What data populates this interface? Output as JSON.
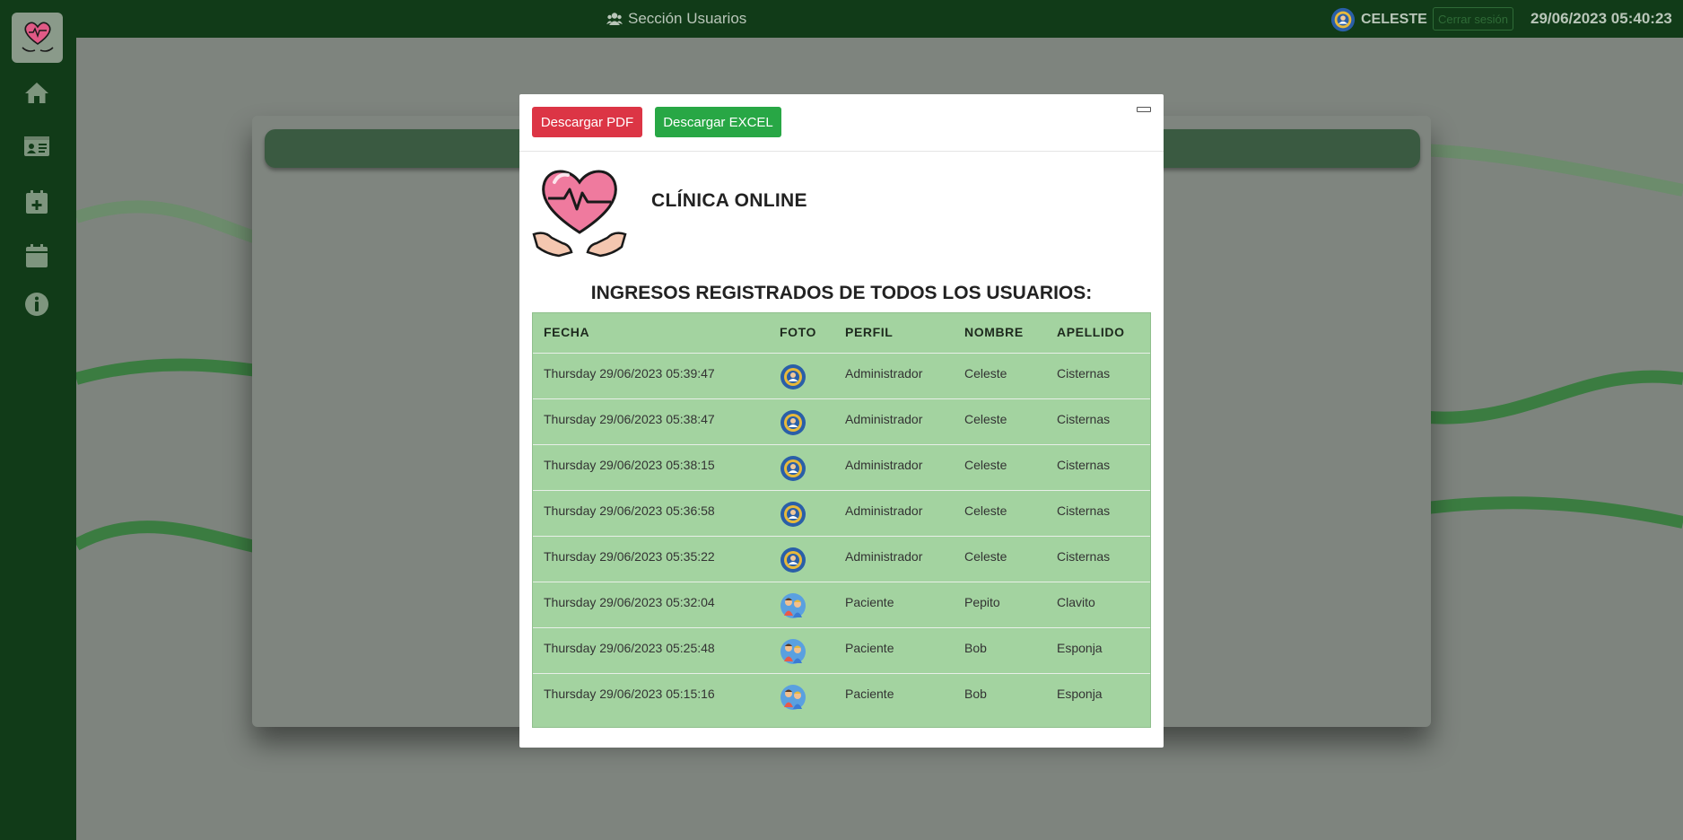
{
  "topbar": {
    "section_title": "Sección Usuarios",
    "section_icon": "users-icon",
    "user_name": "CELESTE",
    "user_icon": "admin-gear-avatar",
    "logout_label": "Cerrar sesión",
    "datetime": "29/06/2023 05:40:23"
  },
  "sidebar": {
    "logo_icon": "heart-hands-logo",
    "items": [
      {
        "icon": "home-icon"
      },
      {
        "icon": "id-card-icon"
      },
      {
        "icon": "calendar-plus-icon"
      },
      {
        "icon": "calendar-icon"
      },
      {
        "icon": "info-icon"
      }
    ]
  },
  "modal": {
    "pdf_label": "Descargar PDF",
    "excel_label": "Descargar EXCEL",
    "clinic_name": "CLÍNICA ONLINE",
    "report_title": "INGRESOS REGISTRADOS DE TODOS LOS USUARIOS:",
    "table": {
      "headers": [
        "FECHA",
        "FOTO",
        "PERFIL",
        "NOMBRE",
        "APELLIDO"
      ],
      "rows": [
        {
          "fecha": "Thursday 29/06/2023 05:39:47",
          "foto": "admin",
          "perfil": "Administrador",
          "nombre": "Celeste",
          "apellido": "Cisternas"
        },
        {
          "fecha": "Thursday 29/06/2023 05:38:47",
          "foto": "admin",
          "perfil": "Administrador",
          "nombre": "Celeste",
          "apellido": "Cisternas"
        },
        {
          "fecha": "Thursday 29/06/2023 05:38:15",
          "foto": "admin",
          "perfil": "Administrador",
          "nombre": "Celeste",
          "apellido": "Cisternas"
        },
        {
          "fecha": "Thursday 29/06/2023 05:36:58",
          "foto": "admin",
          "perfil": "Administrador",
          "nombre": "Celeste",
          "apellido": "Cisternas"
        },
        {
          "fecha": "Thursday 29/06/2023 05:35:22",
          "foto": "admin",
          "perfil": "Administrador",
          "nombre": "Celeste",
          "apellido": "Cisternas"
        },
        {
          "fecha": "Thursday 29/06/2023 05:32:04",
          "foto": "patient",
          "perfil": "Paciente",
          "nombre": "Pepito",
          "apellido": "Clavito"
        },
        {
          "fecha": "Thursday 29/06/2023 05:25:48",
          "foto": "patient",
          "perfil": "Paciente",
          "nombre": "Bob",
          "apellido": "Esponja"
        },
        {
          "fecha": "Thursday 29/06/2023 05:15:16",
          "foto": "patient",
          "perfil": "Paciente",
          "nombre": "Bob",
          "apellido": "Esponja"
        }
      ]
    }
  },
  "colors": {
    "nav_green": "#113b18",
    "pdf_red": "#dc3545",
    "excel_green": "#28a745",
    "table_green": "#a3d3a0"
  }
}
